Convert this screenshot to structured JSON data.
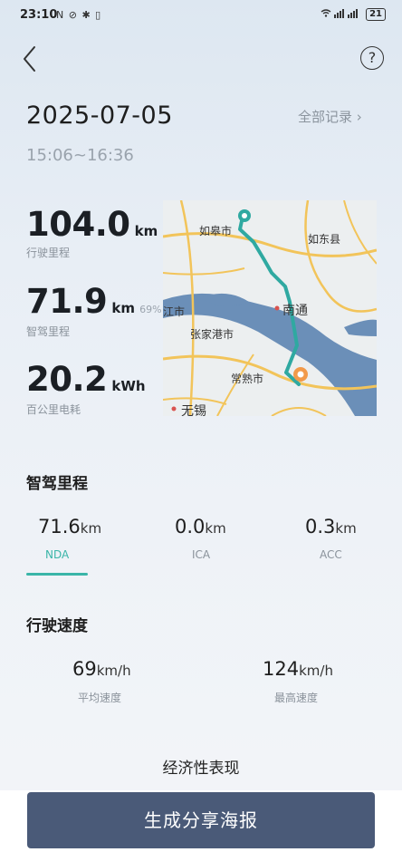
{
  "status_bar": {
    "time": "23:10",
    "left_icons": "N ⊘ ✱ ▯",
    "signal": "📶 ᴴᴰ ᴴᴰ",
    "battery": "21"
  },
  "header": {
    "back_icon": "chevron-left-icon",
    "help_icon": "question-icon",
    "help_glyph": "?"
  },
  "trip": {
    "date": "2025-07-05",
    "all_records": "全部记录 ›",
    "time_range": "15:06~16:36"
  },
  "stats": {
    "distance": {
      "value": "104.0",
      "unit": "km",
      "label": "行驶里程"
    },
    "smart": {
      "value": "71.9",
      "unit": "km",
      "pct": "69%",
      "label": "智驾里程"
    },
    "energy": {
      "value": "20.2",
      "unit": "kWh",
      "label": "百公里电耗"
    }
  },
  "map": {
    "labels": {
      "rugao": "如皋市",
      "rudong": "如东县",
      "jiangyin": "江市",
      "nantong": "南通",
      "zhangjiagang": "张家港市",
      "changshu": "常熟市",
      "wuxi": "无锡"
    },
    "colors": {
      "route": "#2fa9a1",
      "water": "#6b8fb8",
      "road": "#f2c45a",
      "land": "#eceff0"
    }
  },
  "smart_driving": {
    "title": "智驾里程",
    "items": [
      {
        "value": "71.6",
        "unit": "km",
        "label": "NDA"
      },
      {
        "value": "0.0",
        "unit": "km",
        "label": "ICA"
      },
      {
        "value": "0.3",
        "unit": "km",
        "label": "ACC"
      }
    ]
  },
  "speed": {
    "title": "行驶速度",
    "items": [
      {
        "value": "69",
        "unit": "km/h",
        "label": "平均速度"
      },
      {
        "value": "124",
        "unit": "km/h",
        "label": "最高速度"
      }
    ]
  },
  "economy": {
    "title": "经济性表现"
  },
  "actions": {
    "share_label": "生成分享海报"
  },
  "colors": {
    "accent": "#3ab5a8",
    "button": "#4a5a78"
  }
}
